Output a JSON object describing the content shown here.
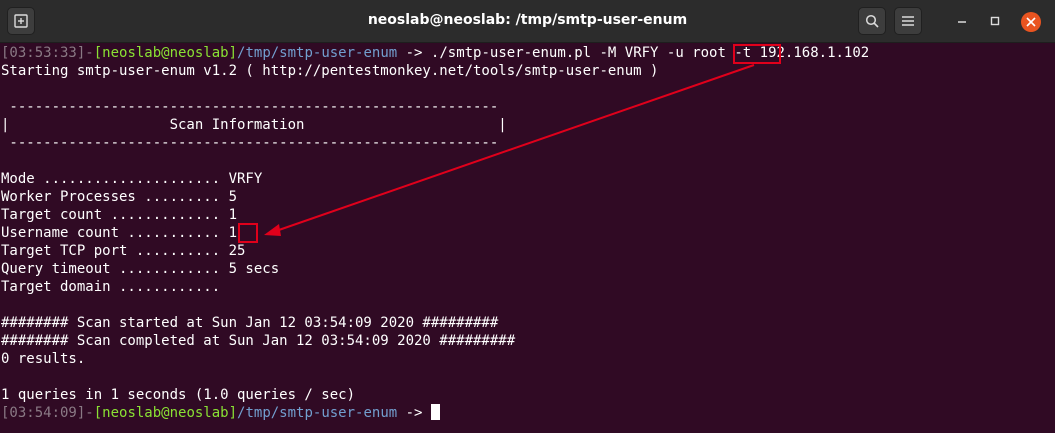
{
  "window": {
    "title": "neoslab@neoslab: /tmp/smtp-user-enum"
  },
  "icons": {
    "new_tab": "new-tab-icon",
    "search": "search-icon",
    "menu": "hamburger-menu-icon",
    "minimize": "minimize-icon",
    "maximize": "maximize-icon",
    "close": "close-icon"
  },
  "colors": {
    "terminal_bg": "#300a24",
    "prompt_user": "#8ae234",
    "prompt_path": "#729fcf",
    "prompt_time": "#8a7a85",
    "annotation": "#e0001b",
    "close_button": "#e95420"
  },
  "terminal": {
    "prompt1": {
      "time": "[03:53:33]",
      "dash": "-",
      "user": "[neoslab@neoslab]",
      "path": "/tmp/smtp-user-enum",
      "arrow": " -> ",
      "cmd_before": "./smtp-user-enum.pl -M VRFY -u ",
      "cmd_user": "root",
      "cmd_after": " -t 192.168.1.102"
    },
    "starting": "Starting smtp-user-enum v1.2 ( http://pentestmonkey.net/tools/smtp-user-enum )",
    "rule_top": " ----------------------------------------------------------",
    "header": "|                   Scan Information                       |",
    "rule_bottom": " ----------------------------------------------------------",
    "info": {
      "mode": "Mode ..................... VRFY",
      "workers": "Worker Processes ......... 5",
      "targets": "Target count ............. 1",
      "username_label": "Username count ........... ",
      "username_value": "1",
      "port": "Target TCP port .......... 25",
      "timeout": "Query timeout ............ 5 secs",
      "domain": "Target domain ............"
    },
    "scan_started": "######## Scan started at Sun Jan 12 03:54:09 2020 #########",
    "scan_completed": "######## Scan completed at Sun Jan 12 03:54:09 2020 #########",
    "results": "0 results.",
    "queries": "1 queries in 1 seconds (1.0 queries / sec)",
    "prompt2": {
      "time": "[03:54:09]",
      "dash": "-",
      "user": "[neoslab@neoslab]",
      "path": "/tmp/smtp-user-enum",
      "arrow": " -> "
    }
  }
}
